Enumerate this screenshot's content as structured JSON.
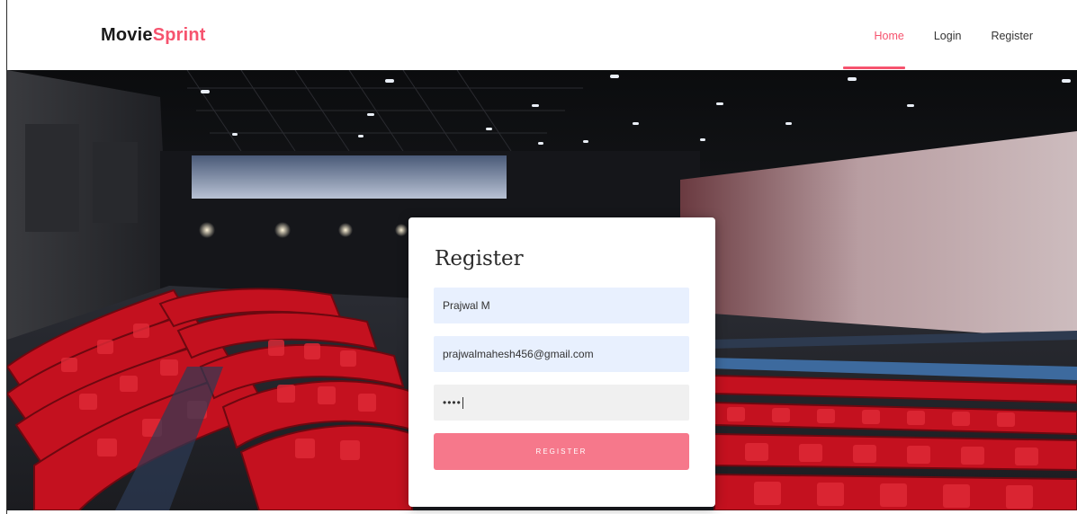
{
  "header": {
    "brand_primary": "Movie",
    "brand_accent": "Sprint",
    "nav": [
      {
        "label": "Home",
        "active": true
      },
      {
        "label": "Login",
        "active": false
      },
      {
        "label": "Register",
        "active": false
      }
    ]
  },
  "form": {
    "title": "Register",
    "name_value": "Prajwal M",
    "email_value": "prajwalmahesh456@gmail.com",
    "password_masked": "••••",
    "submit_label": "REGISTER"
  },
  "colors": {
    "accent": "#f6536e",
    "button": "#f6788b",
    "autofill": "#e8f0fe",
    "seat_red": "#c4111f"
  }
}
